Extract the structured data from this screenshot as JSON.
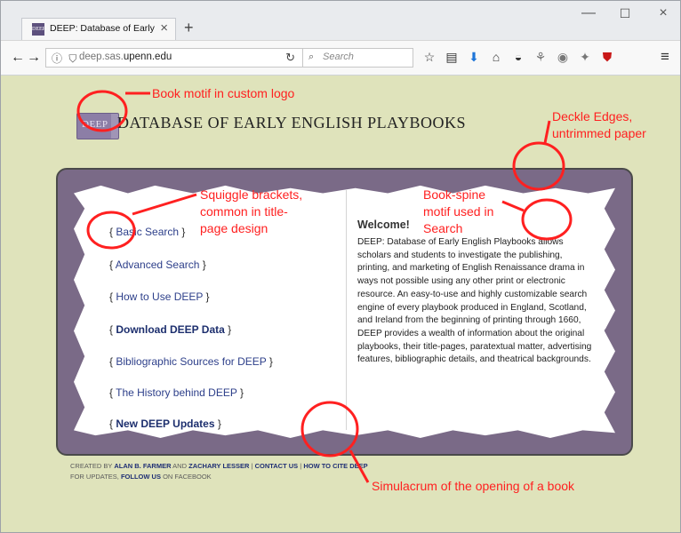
{
  "browser": {
    "tab_title": "DEEP: Database of Early En...",
    "favicon_text": "DEEP",
    "url_prefix": "deep.sas.",
    "url_domain": "upenn.edu",
    "search_placeholder": "Search"
  },
  "site": {
    "logo_book_text": "DEEP",
    "title": "DATABASE OF EARLY ENGLISH PLAYBOOKS",
    "links": [
      {
        "label": "Basic Search",
        "bold": false
      },
      {
        "label": "Advanced Search",
        "bold": false
      },
      {
        "label": "How to Use DEEP",
        "bold": false
      },
      {
        "label": "Download DEEP Data",
        "bold": true
      },
      {
        "label": "Bibliographic Sources for DEEP",
        "bold": false
      },
      {
        "label": "The History behind DEEP",
        "bold": false
      },
      {
        "label": "New DEEP Updates",
        "bold": true
      }
    ],
    "welcome_title": "Welcome!",
    "welcome_text": "DEEP: Database of Early English Playbooks allows scholars and students to investigate the publishing, printing, and marketing of English Renaissance drama in ways not possible using any other print or electronic resource. An easy-to-use and highly customizable search engine of every playbook produced in England, Scotland, and Ireland from the beginning of printing through 1660, DEEP provides a wealth of information about the original playbooks, their title-pages, paratextual matter, advertising features, bibliographic details, and theatrical backgrounds.",
    "footer": {
      "created_by": "CREATED BY",
      "author_1": "ALAN B. FARMER",
      "and": "AND",
      "author_2": "ZACHARY LESSER",
      "contact": "CONTACT US",
      "cite": "HOW TO CITE DEEP",
      "updates_prefix": "FOR UPDATES,",
      "follow": "FOLLOW US",
      "updates_suffix": "ON FACEBOOK"
    }
  },
  "annotations": {
    "book_motif": "Book motif in custom logo",
    "deckle_1": "Deckle Edges,",
    "deckle_2": "untrimmed paper",
    "squiggle_1": "Squiggle brackets,",
    "squiggle_2": "common in title-",
    "squiggle_3": "page design",
    "spine_1": "Book-spine",
    "spine_2": "motif used in",
    "spine_3": "Search",
    "simulacrum": "Simulacrum of the opening of a book"
  },
  "colors": {
    "page_bg": "#dfe3bb",
    "frame": "#7a6a87",
    "annotation_red": "#ff2020",
    "link_blue": "#2d3f8a"
  }
}
